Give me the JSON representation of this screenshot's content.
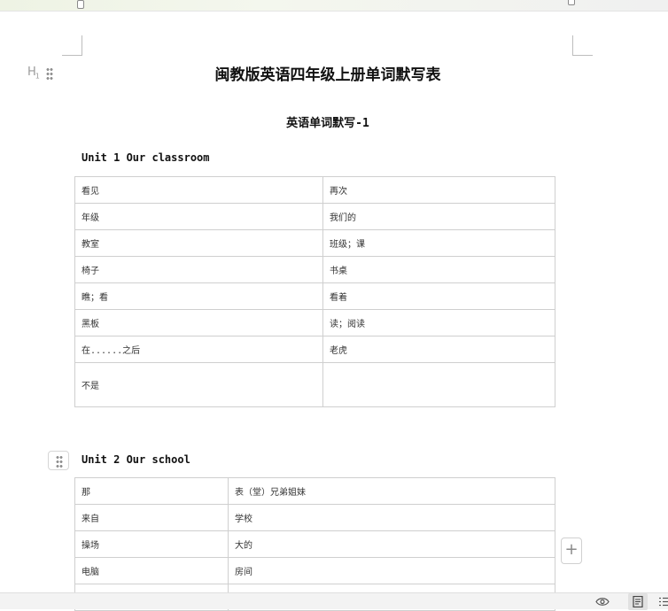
{
  "document": {
    "title": "闽教版英语四年级上册单词默写表",
    "subtitle": "英语单词默写-1",
    "heading_tag": "H",
    "heading_tag_level": "1"
  },
  "units": [
    {
      "heading": "Unit 1 Our classroom",
      "rows": [
        [
          "看见",
          "再次"
        ],
        [
          "年级",
          "我们的"
        ],
        [
          "教室",
          "班级；课"
        ],
        [
          "椅子",
          "书桌"
        ],
        [
          "瞧；看",
          "看着"
        ],
        [
          "黑板",
          "读；阅读"
        ],
        [
          "在......之后",
          "老虎"
        ],
        [
          "不是",
          ""
        ]
      ]
    },
    {
      "heading": "Unit 2 Our school",
      "rows": [
        [
          "那",
          "表（堂）兄弟姐妹"
        ],
        [
          "来自",
          "学校"
        ],
        [
          "操场",
          "大的"
        ],
        [
          "电脑",
          "房间"
        ],
        [
          "",
          ""
        ]
      ]
    }
  ],
  "controls": {
    "add_button_label": "+"
  },
  "icons": {
    "heading_drag": "drag-handle-icon",
    "block_drag": "drag-handle-icon",
    "read_mode": "eye-icon",
    "page_view": "page-view-icon",
    "outline": "outline-icon"
  },
  "colors": {
    "ruler": "#eef3e4",
    "table_border": "#cfcfcf",
    "statusbar": "#f3f3f3"
  }
}
